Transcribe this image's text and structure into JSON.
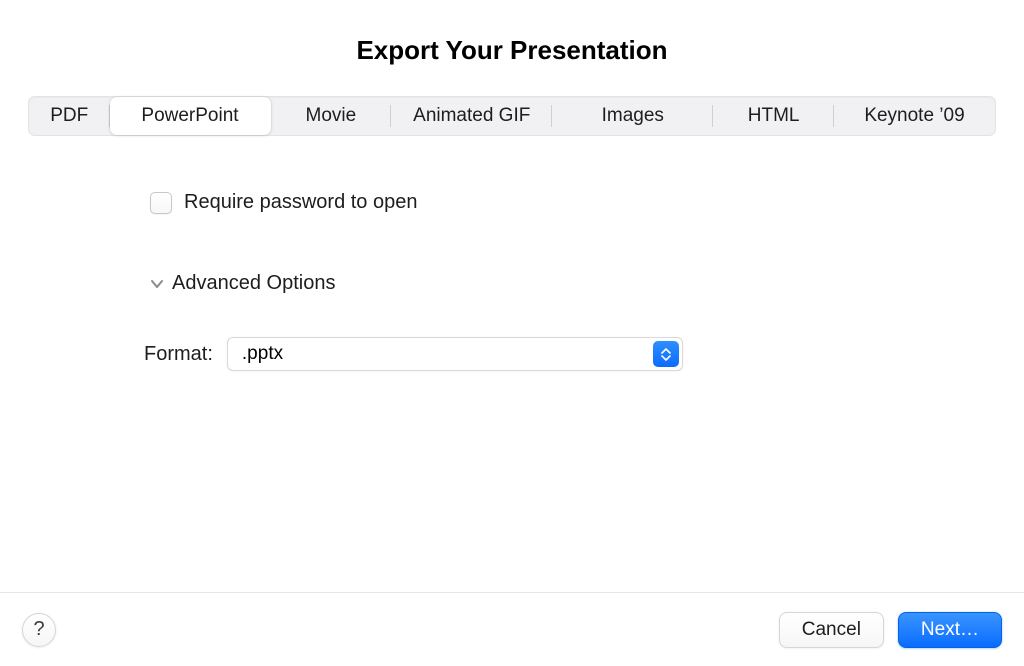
{
  "dialog": {
    "title": "Export Your Presentation"
  },
  "tabs": {
    "items": [
      {
        "label": "PDF"
      },
      {
        "label": "PowerPoint"
      },
      {
        "label": "Movie"
      },
      {
        "label": "Animated GIF"
      },
      {
        "label": "Images"
      },
      {
        "label": "HTML"
      },
      {
        "label": "Keynote ’09"
      }
    ],
    "active_index": 1
  },
  "options": {
    "require_password_label": "Require password to open",
    "require_password_checked": false,
    "advanced_label": "Advanced Options",
    "advanced_expanded": true,
    "format_label": "Format:",
    "format_value": ".pptx"
  },
  "footer": {
    "help_label": "?",
    "cancel_label": "Cancel",
    "next_label": "Next…"
  }
}
